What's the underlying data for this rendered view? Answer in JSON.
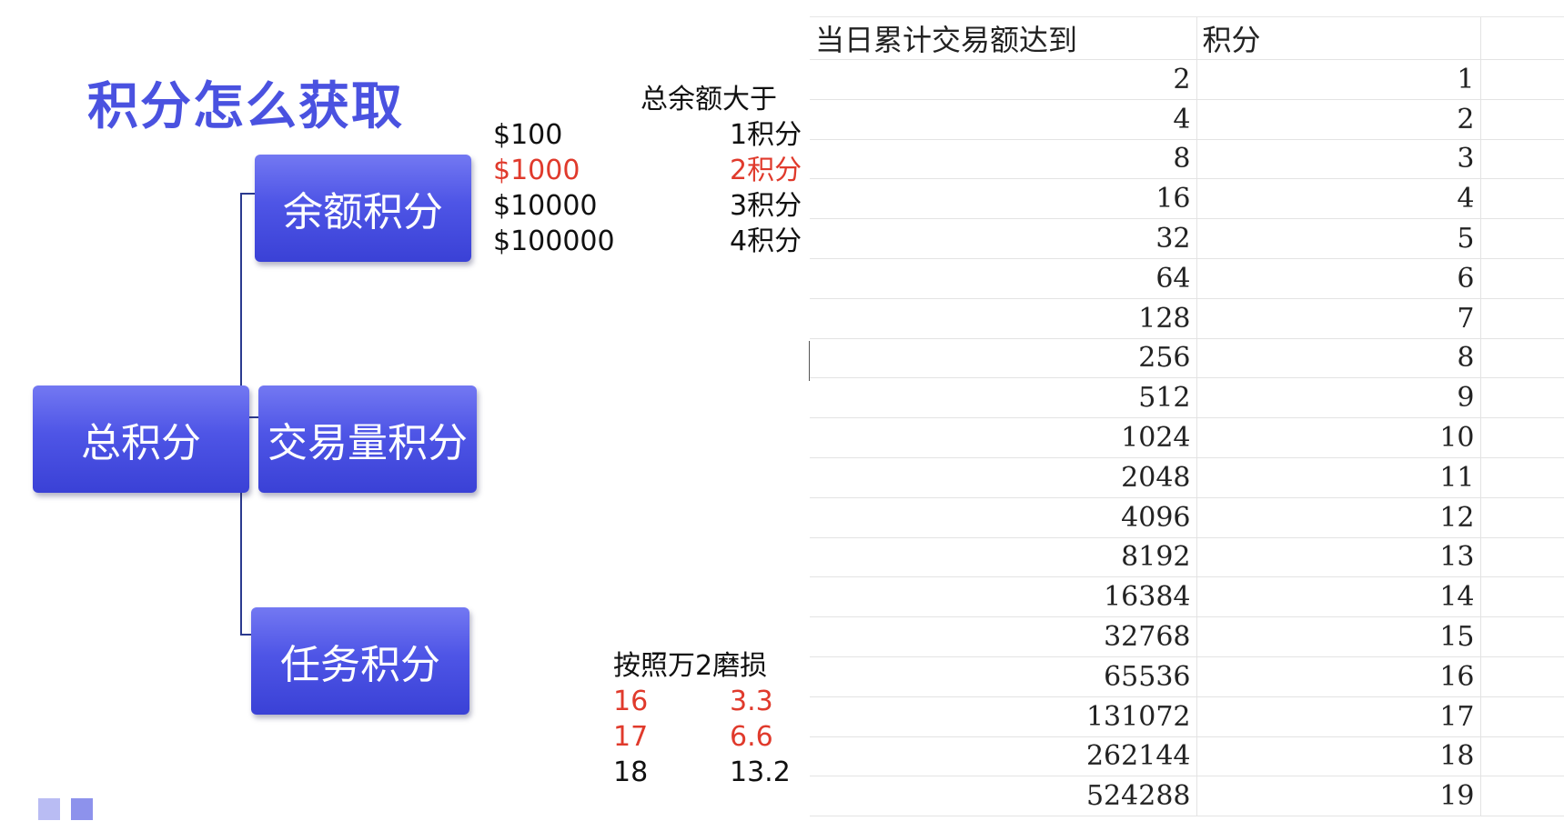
{
  "slide": {
    "title": "积分怎么获取",
    "boxes": {
      "total": "总积分",
      "balance": "余额积分",
      "volume": "交易量积分",
      "task": "任务积分"
    }
  },
  "balance_tiers": {
    "header": "总余额大于",
    "rows": [
      {
        "amount": "$100",
        "points": "1积分",
        "highlight": false
      },
      {
        "amount": "$1000",
        "points": "2积分",
        "highlight": true
      },
      {
        "amount": "$10000",
        "points": "3积分",
        "highlight": false
      },
      {
        "amount": "$100000",
        "points": "4积分",
        "highlight": false
      }
    ]
  },
  "wear_note": {
    "header": "按照万2磨损",
    "rows": [
      {
        "a": "16",
        "b": "3.3",
        "highlight": true
      },
      {
        "a": "17",
        "b": "6.6",
        "highlight": true
      },
      {
        "a": "18",
        "b": "13.2",
        "highlight": false
      }
    ]
  },
  "sheet": {
    "headers": [
      "当日累计交易额达到",
      "积分"
    ],
    "rows": [
      [
        "2",
        "1"
      ],
      [
        "4",
        "2"
      ],
      [
        "8",
        "3"
      ],
      [
        "16",
        "4"
      ],
      [
        "32",
        "5"
      ],
      [
        "64",
        "6"
      ],
      [
        "128",
        "7"
      ],
      [
        "256",
        "8"
      ],
      [
        "512",
        "9"
      ],
      [
        "1024",
        "10"
      ],
      [
        "2048",
        "11"
      ],
      [
        "4096",
        "12"
      ],
      [
        "8192",
        "13"
      ],
      [
        "16384",
        "14"
      ],
      [
        "32768",
        "15"
      ],
      [
        "65536",
        "16"
      ],
      [
        "131072",
        "17"
      ],
      [
        "262144",
        "18"
      ],
      [
        "524288",
        "19"
      ]
    ]
  },
  "colors": {
    "accent": "#4a52e0",
    "highlight_red": "#e03a2c",
    "deco_square_1": "#b9bcf3",
    "deco_square_2": "#8d92ec"
  }
}
